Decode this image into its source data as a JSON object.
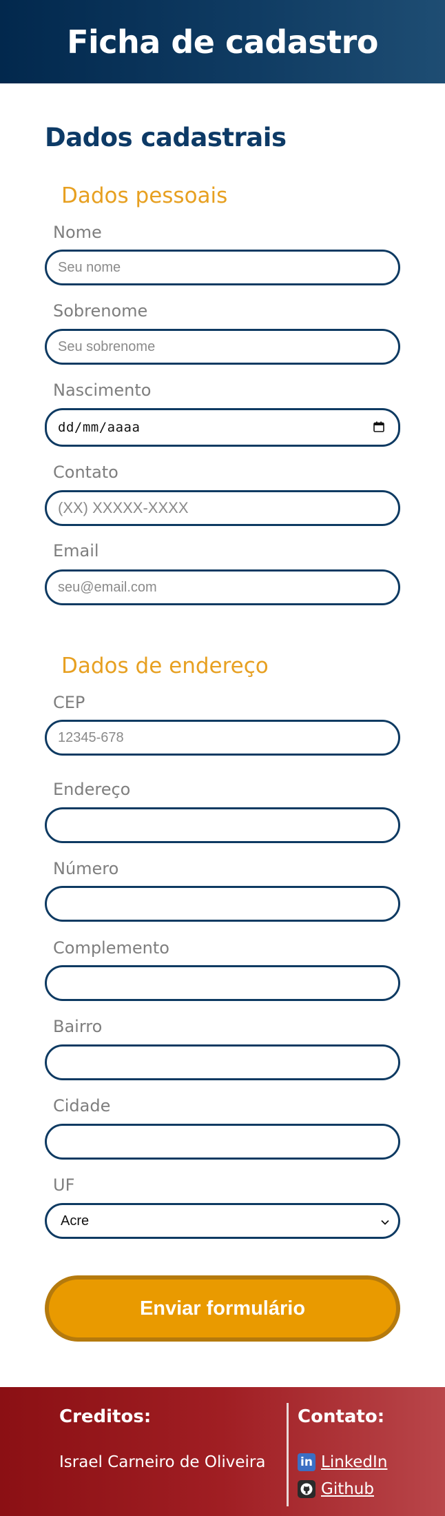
{
  "header": {
    "title": "Ficha de cadastro"
  },
  "form": {
    "title": "Dados cadastrais",
    "personal": {
      "title": "Dados pessoais",
      "nome": {
        "label": "Nome",
        "placeholder": "Seu nome"
      },
      "sobrenome": {
        "label": "Sobrenome",
        "placeholder": "Seu sobrenome"
      },
      "nascimento": {
        "label": "Nascimento",
        "placeholder": "dd/mm/aaaa"
      },
      "contato": {
        "label": "Contato",
        "placeholder": "(XX) XXXXX-XXXX"
      },
      "email": {
        "label": "Email",
        "placeholder": "seu@email.com"
      }
    },
    "address": {
      "title": "Dados de endereço",
      "cep": {
        "label": "CEP",
        "placeholder": "12345-678"
      },
      "endereco": {
        "label": "Endereço",
        "value": ""
      },
      "numero": {
        "label": "Número",
        "value": ""
      },
      "complemento": {
        "label": "Complemento",
        "value": ""
      },
      "bairro": {
        "label": "Bairro",
        "value": ""
      },
      "cidade": {
        "label": "Cidade",
        "value": ""
      },
      "uf": {
        "label": "UF",
        "selected": "Acre"
      }
    },
    "submit_label": "Enviar formulário"
  },
  "footer": {
    "credits_title": "Creditos:",
    "author": "Israel Carneiro de Oliveira",
    "contact_title": "Contato:",
    "linkedin_label": "LinkedIn",
    "github_label": "Github"
  },
  "colors": {
    "header_bg": "#0f3b62",
    "accent_orange": "#e99a00",
    "field_border": "#0e3a62",
    "footer_bg": "#a01e23"
  },
  "icons": [
    "calendar-icon",
    "chevron-down-icon",
    "linkedin-icon",
    "github-icon"
  ]
}
